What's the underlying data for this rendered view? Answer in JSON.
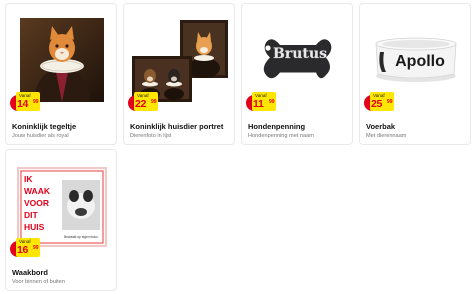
{
  "products": [
    {
      "title": "Koninklijk tegeltje",
      "subtitle": "Jouw huisdier als royal",
      "price_prefix": "Vanaf",
      "price_whole": "14",
      "price_cents": "99"
    },
    {
      "title": "Koninklijk huisdier portret",
      "subtitle": "Dierenfoto in lijst",
      "price_prefix": "Vanaf",
      "price_whole": "22",
      "price_cents": "99"
    },
    {
      "title": "Hondenpenning",
      "subtitle": "Hondenpenning met naam",
      "price_prefix": "Vanaf",
      "price_whole": "11",
      "price_cents": "99"
    },
    {
      "title": "Voerbak",
      "subtitle": "Met dierennaam",
      "price_prefix": "Vanaf",
      "price_whole": "25",
      "price_cents": "99"
    },
    {
      "title": "Waakbord",
      "subtitle": "Voor binnen of buiten",
      "price_prefix": "Vanaf",
      "price_whole": "16",
      "price_cents": "99"
    }
  ],
  "product_images": {
    "tag_name": "Brutus",
    "bowl_name": "Apollo",
    "sign_text": [
      "IK",
      "WAAK",
      "VOOR",
      "DIT",
      "HUIS"
    ],
    "sign_caption": "Bewaakt op eigen risico"
  },
  "colors": {
    "price_red": "#e2001a",
    "price_yellow": "#ffe600",
    "card_border": "#e9e9e9"
  }
}
